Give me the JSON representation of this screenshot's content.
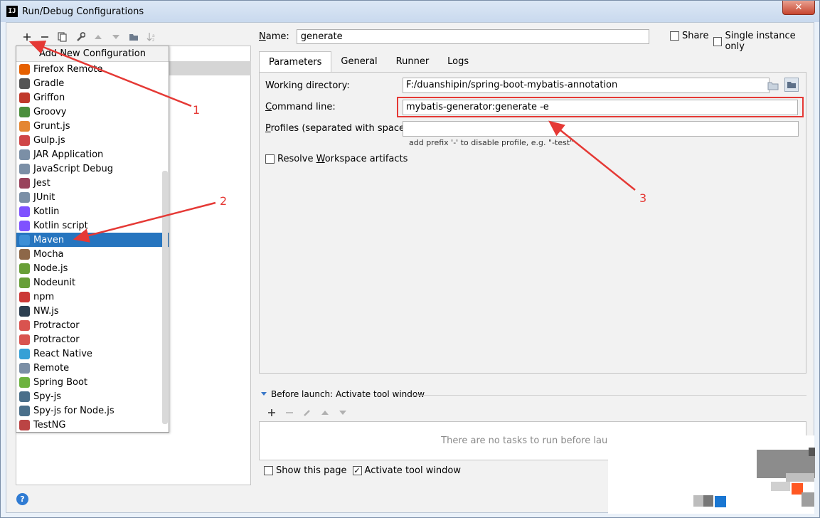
{
  "window": {
    "title": "Run/Debug Configurations",
    "close_label": "✕"
  },
  "toolbar": {
    "icons": [
      "plus-icon",
      "minus-icon",
      "copy-icon",
      "wrench-icon",
      "arrow-up-icon",
      "arrow-down-icon",
      "folder-icon",
      "sort-icon"
    ]
  },
  "popup": {
    "header": "Add New Configuration",
    "items": [
      {
        "label": "Firefox Remote",
        "icon": "firefox-icon",
        "color": "#e66000"
      },
      {
        "label": "Gradle",
        "icon": "gradle-icon",
        "color": "#555555"
      },
      {
        "label": "Griffon",
        "icon": "griffon-icon",
        "color": "#c0392b"
      },
      {
        "label": "Groovy",
        "icon": "groovy-icon",
        "color": "#4b8f3c"
      },
      {
        "label": "Grunt.js",
        "icon": "grunt-icon",
        "color": "#e48632"
      },
      {
        "label": "Gulp.js",
        "icon": "gulp-icon",
        "color": "#cf4647"
      },
      {
        "label": "JAR Application",
        "icon": "jar-icon",
        "color": "#7b8fa6"
      },
      {
        "label": "JavaScript Debug",
        "icon": "js-debug-icon",
        "color": "#7b8fa6"
      },
      {
        "label": "Jest",
        "icon": "jest-icon",
        "color": "#99425b"
      },
      {
        "label": "JUnit",
        "icon": "junit-icon",
        "color": "#7b8fa6"
      },
      {
        "label": "Kotlin",
        "icon": "kotlin-icon",
        "color": "#7f52ff"
      },
      {
        "label": "Kotlin script",
        "icon": "kotlin-script-icon",
        "color": "#7f52ff"
      },
      {
        "label": "Maven",
        "icon": "maven-icon",
        "color": "#3d8fd6"
      },
      {
        "label": "Mocha",
        "icon": "mocha-icon",
        "color": "#8d6748"
      },
      {
        "label": "Node.js",
        "icon": "nodejs-icon",
        "color": "#689f38"
      },
      {
        "label": "Nodeunit",
        "icon": "nodeunit-icon",
        "color": "#689f38"
      },
      {
        "label": "npm",
        "icon": "npm-icon",
        "color": "#cb3837"
      },
      {
        "label": "NW.js",
        "icon": "nwjs-icon",
        "color": "#2c3e50"
      },
      {
        "label": "Protractor",
        "icon": "protractor-icon",
        "color": "#d9534f"
      },
      {
        "label": "Protractor",
        "icon": "protractor-icon",
        "color": "#d9534f"
      },
      {
        "label": "React Native",
        "icon": "react-icon",
        "color": "#35a0d6"
      },
      {
        "label": "Remote",
        "icon": "remote-icon",
        "color": "#7b8fa6"
      },
      {
        "label": "Spring Boot",
        "icon": "spring-boot-icon",
        "color": "#6db33f"
      },
      {
        "label": "Spy-js",
        "icon": "spyjs-icon",
        "color": "#4a6f8a"
      },
      {
        "label": "Spy-js for Node.js",
        "icon": "spyjs-node-icon",
        "color": "#4a6f8a"
      },
      {
        "label": "TestNG",
        "icon": "testng-icon",
        "color": "#b44"
      }
    ],
    "selected_index": 12
  },
  "name": {
    "label": "Name:",
    "value": "generate"
  },
  "share_label": "Share",
  "single_instance_label": "Single instance only",
  "tabs": [
    "Parameters",
    "General",
    "Runner",
    "Logs"
  ],
  "active_tab": "Parameters",
  "params": {
    "working_dir_label": "Working directory:",
    "working_dir_value": "F:/duanshipin/spring-boot-mybatis-annotation",
    "command_line_label": "Command line:",
    "command_line_value": "mybatis-generator:generate -e",
    "profiles_label": "Profiles (separated with space):",
    "profiles_value": "",
    "profiles_hint": "add prefix '-' to disable profile, e.g. \"-test\"",
    "resolve_label": "Resolve Workspace artifacts"
  },
  "before_launch": {
    "title": "Before launch: Activate tool window",
    "empty_text": "There are no tasks to run before launch"
  },
  "bottom": {
    "show_page_label": "Show this page",
    "activate_tool_label": "Activate tool window"
  },
  "annotations": {
    "n1": "1",
    "n2": "2",
    "n3": "3",
    "color": "#e53935"
  },
  "colors": {
    "selection": "#2675bf",
    "highlight": "#e53935"
  }
}
